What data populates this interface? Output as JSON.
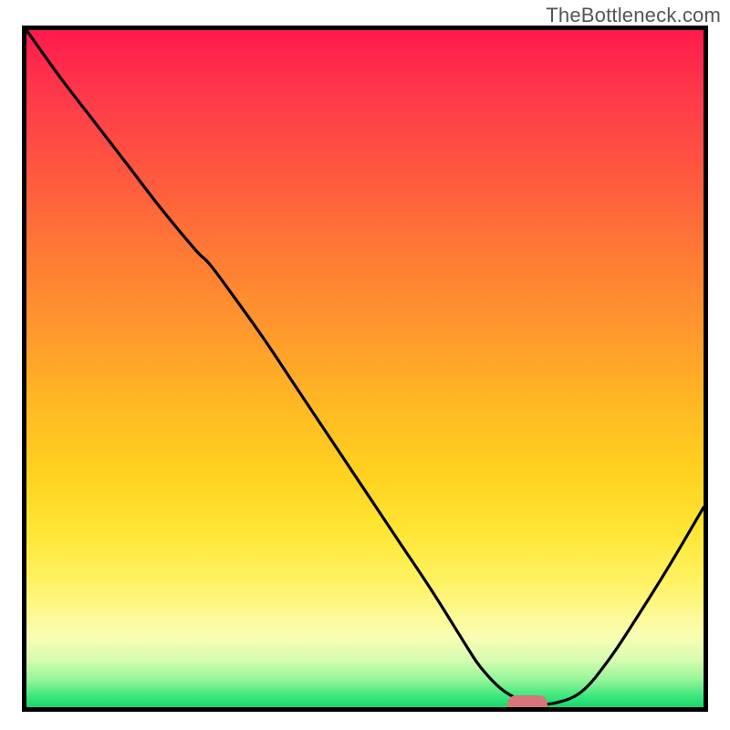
{
  "watermark": "TheBottleneck.com",
  "chart_data": {
    "type": "line",
    "title": "",
    "xlabel": "",
    "ylabel": "",
    "xlim": [
      0,
      100
    ],
    "ylim": [
      0,
      100
    ],
    "grid": false,
    "legend": false,
    "series": [
      {
        "name": "curve",
        "color": "#000000",
        "x": [
          0.0,
          5,
          10,
          15,
          20,
          25,
          27,
          30,
          35,
          40,
          45,
          50,
          55,
          60,
          65,
          67,
          70,
          73,
          75,
          78,
          82,
          86,
          90,
          95,
          100
        ],
        "y": [
          100,
          93,
          86.5,
          80,
          73.5,
          67.5,
          65.5,
          61.5,
          54.5,
          47,
          39.5,
          32,
          24.5,
          17,
          9,
          6,
          2.8,
          1.0,
          0.6,
          0.6,
          2.3,
          7.0,
          13.0,
          21.0,
          29.5
        ]
      }
    ],
    "markers": [
      {
        "name": "min-marker",
        "shape": "pill",
        "color": "#d9757a",
        "x_center": 74,
        "y_center": 0.5,
        "width_x": 6.0,
        "height_y": 2.6
      }
    ],
    "background_gradient": {
      "from": "#ff1a4d",
      "to": "#18d66e",
      "stops": [
        "red",
        "orange",
        "yellow",
        "pale-yellow",
        "green"
      ]
    }
  }
}
